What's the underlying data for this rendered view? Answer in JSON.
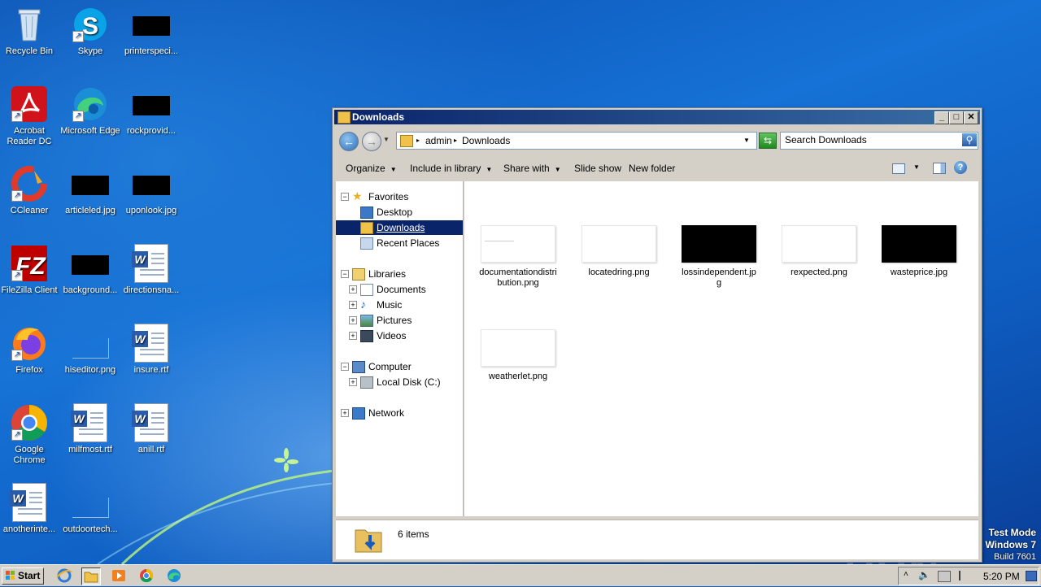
{
  "desktop": {
    "icons": [
      {
        "label": "Recycle Bin"
      },
      {
        "label": "Skype"
      },
      {
        "label": "printerspeci..."
      },
      {
        "label": "Acrobat Reader DC"
      },
      {
        "label": "Microsoft Edge"
      },
      {
        "label": "rockprovid..."
      },
      {
        "label": "CCleaner"
      },
      {
        "label": "articleled.jpg"
      },
      {
        "label": "uponlook.jpg"
      },
      {
        "label": "FileZilla Client"
      },
      {
        "label": "background..."
      },
      {
        "label": "directionsna..."
      },
      {
        "label": "Firefox"
      },
      {
        "label": "hiseditor.png"
      },
      {
        "label": "insure.rtf"
      },
      {
        "label": "Google Chrome"
      },
      {
        "label": "milfmost.rtf"
      },
      {
        "label": "anill.rtf"
      },
      {
        "label": "anotherinte..."
      },
      {
        "label": "outdoortech..."
      }
    ],
    "watermark": "ANY RUN",
    "test_mode": {
      "line1": "Test Mode",
      "line2": "Windows 7",
      "line3": "Build 7601"
    }
  },
  "window": {
    "title": "Downloads",
    "address": {
      "crumb1": "admin",
      "crumb2": "Downloads"
    },
    "search": {
      "placeholder": "Search Downloads"
    },
    "toolbar": {
      "organize": "Organize",
      "include_in_library": "Include in library",
      "share_with": "Share with",
      "slide_show": "Slide show",
      "new_folder": "New folder"
    },
    "nav": {
      "favorites": "Favorites",
      "desktop": "Desktop",
      "downloads": "Downloads",
      "recent_places": "Recent Places",
      "libraries": "Libraries",
      "documents": "Documents",
      "music": "Music",
      "pictures": "Pictures",
      "videos": "Videos",
      "computer": "Computer",
      "local_disk": "Local Disk (C:)",
      "network": "Network"
    },
    "files": [
      {
        "name": "documentationdistribution.png"
      },
      {
        "name": "locatedring.png"
      },
      {
        "name": "lossindependent.jpg"
      },
      {
        "name": "rexpected.png"
      },
      {
        "name": "wasteprice.jpg"
      },
      {
        "name": "weatherlet.png"
      }
    ],
    "status": {
      "count": "6 items"
    }
  },
  "taskbar": {
    "start": "Start",
    "clock": "5:20 PM"
  }
}
